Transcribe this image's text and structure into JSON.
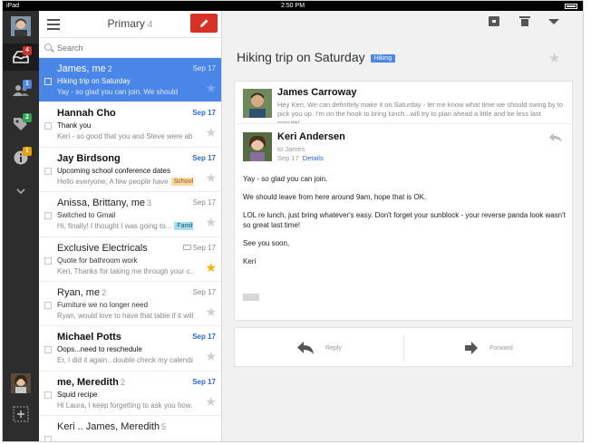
{
  "status_bar": {
    "carrier": "iPad",
    "time": "2:50 PM"
  },
  "rail": {
    "badges": {
      "inbox": "4",
      "people": "1",
      "tags": "2",
      "info": "1"
    }
  },
  "list": {
    "title": "Primary",
    "count": "4",
    "search_placeholder": "Search",
    "threads": [
      {
        "from": "James, me",
        "count": "2",
        "date": "Sep 17",
        "subject": "Hiking trip on Saturday",
        "snippet": "Yay - so glad you can join. We should",
        "label": "",
        "starred": false
      },
      {
        "from": "Hannah Cho",
        "count": "",
        "date": "Sep 17",
        "subject": "Thank you",
        "snippet": "Keri - so good that you and Steve were ab...",
        "label": "",
        "starred": false
      },
      {
        "from": "Jay Birdsong",
        "count": "",
        "date": "Sep 17",
        "subject": "Upcoming school conference dates",
        "snippet": "Hello everyone, A few people have",
        "label": "School",
        "starred": false
      },
      {
        "from": "Anissa, Brittany, me",
        "count": "3",
        "date": "Sep 17",
        "subject": "Switched to Gmail",
        "snippet": "Hi, finally! I thought I was going to...",
        "label": "Family",
        "starred": false
      },
      {
        "from": "Exclusive Electricals",
        "count": "",
        "date": "Sep 17",
        "subject": "Quote for bathroom work",
        "snippet": "Keri, Thanks for taking me through your c...",
        "label": "",
        "starred": true
      },
      {
        "from": "Ryan, me",
        "count": "2",
        "date": "Sep 17",
        "subject": "Furniture we no longer need",
        "snippet": "Ryan, would love to have that table if it will...",
        "label": "",
        "starred": false
      },
      {
        "from": "Michael Potts",
        "count": "",
        "date": "Sep 17",
        "subject": "Oops...need to reschedule",
        "snippet": "Er, I did it again...double check my calendar...",
        "label": "",
        "starred": false
      },
      {
        "from": "me, Meredith",
        "count": "2",
        "date": "Sep 17",
        "subject": "Squid recipe",
        "snippet": "Hi Laura, I keep forgetting to ask you how...",
        "label": "",
        "starred": false
      },
      {
        "from": "Keri .. James, Meredith",
        "count": "5",
        "date": "",
        "subject": "",
        "snippet": "",
        "label": "",
        "starred": false
      }
    ]
  },
  "conversation": {
    "title": "Hiking trip on Saturday",
    "label": "Hiking",
    "collapsed_message": {
      "sender": "James Carroway",
      "preview": "Hey Keri, We can definitely make it on Saturday - let me know what time we should swing by to pick you up. I'm on the hook to bring lunch...will try to plan ahead a little and be less last minute!"
    },
    "open_message": {
      "sender": "Keri Andersen",
      "to": "to James",
      "date": "Sep 17",
      "details_link": "Details",
      "body": [
        "Yay - so glad you can join.",
        "We should leave from here around 9am, hope that is OK.",
        "LOL re lunch, just bring whatever's easy. Don't forget your sunblock - your reverse panda look wasn't so great last time!",
        "See you soon,",
        "Keri"
      ]
    },
    "actions": {
      "reply": "Reply",
      "forward": "Forward"
    }
  },
  "colors": {
    "accent_blue": "#4a86e8",
    "compose_red": "#d93025",
    "rail_dark": "#2d2d2d",
    "star_yellow": "#f4b400"
  }
}
